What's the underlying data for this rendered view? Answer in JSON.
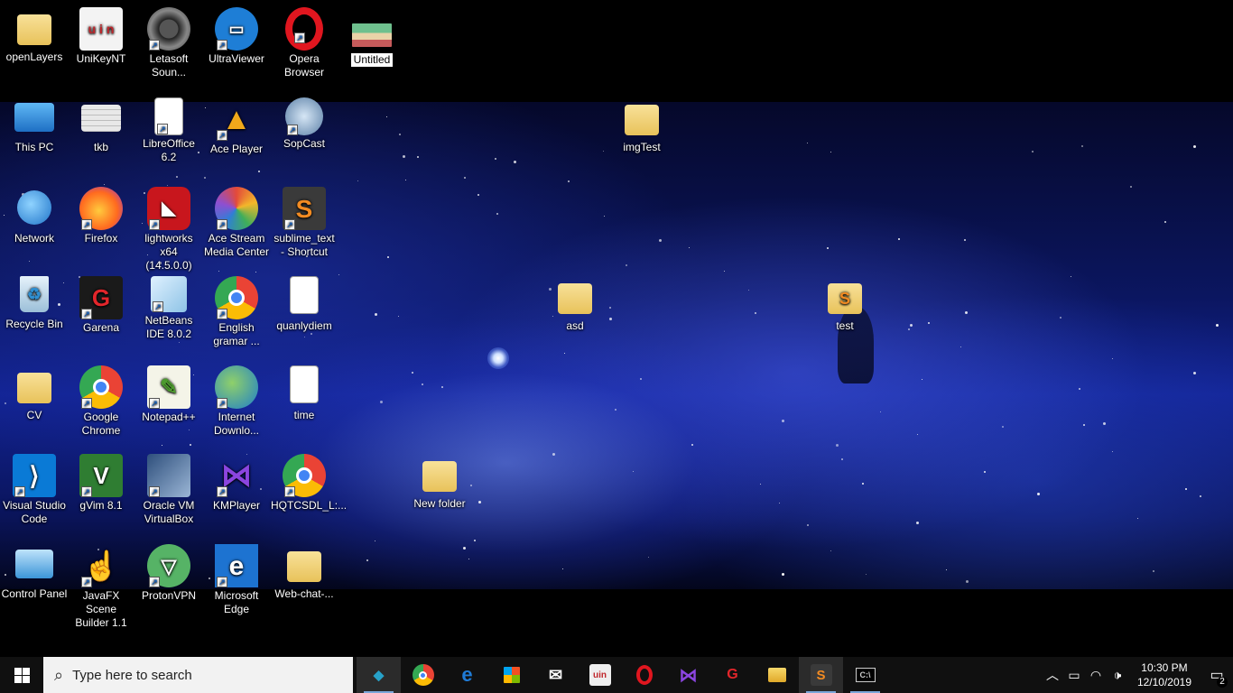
{
  "desktop": {
    "icons": [
      {
        "label": "openLayers",
        "kind": "folder"
      },
      {
        "label": "UniKeyNT",
        "kind": "app"
      },
      {
        "label": "Letasoft Soun...",
        "kind": "app"
      },
      {
        "label": "UltraViewer",
        "kind": "app"
      },
      {
        "label": "Opera Browser",
        "kind": "app"
      },
      {
        "label": "Untitled",
        "kind": "image",
        "renaming": true
      },
      {
        "label": "This PC",
        "kind": "system"
      },
      {
        "label": "tkb",
        "kind": "file"
      },
      {
        "label": "LibreOffice 6.2",
        "kind": "app"
      },
      {
        "label": "Ace Player",
        "kind": "app"
      },
      {
        "label": "SopCast",
        "kind": "app"
      },
      {
        "label": "imgTest",
        "kind": "folder"
      },
      {
        "label": "Network",
        "kind": "system"
      },
      {
        "label": "Firefox",
        "kind": "app"
      },
      {
        "label": "lightworks x64 (14.5.0.0)",
        "kind": "app"
      },
      {
        "label": "Ace Stream Media Center",
        "kind": "app"
      },
      {
        "label": "sublime_text - Shortcut",
        "kind": "app"
      },
      {
        "label": "Recycle Bin",
        "kind": "system"
      },
      {
        "label": "Garena",
        "kind": "app"
      },
      {
        "label": "NetBeans IDE 8.0.2",
        "kind": "app"
      },
      {
        "label": "English gramar ...",
        "kind": "app"
      },
      {
        "label": "quanlydiem",
        "kind": "file"
      },
      {
        "label": "asd",
        "kind": "folder"
      },
      {
        "label": "test",
        "kind": "folder"
      },
      {
        "label": "CV",
        "kind": "folder"
      },
      {
        "label": "Google Chrome",
        "kind": "app"
      },
      {
        "label": "Notepad++",
        "kind": "app"
      },
      {
        "label": "Internet Downlo...",
        "kind": "app"
      },
      {
        "label": "time",
        "kind": "file"
      },
      {
        "label": "Visual Studio Code",
        "kind": "app"
      },
      {
        "label": "gVim 8.1",
        "kind": "app"
      },
      {
        "label": "Oracle VM VirtualBox",
        "kind": "app"
      },
      {
        "label": "KMPlayer",
        "kind": "app"
      },
      {
        "label": "HQTCSDL_L:...",
        "kind": "app"
      },
      {
        "label": "New folder",
        "kind": "folder"
      },
      {
        "label": "Control Panel",
        "kind": "system"
      },
      {
        "label": "JavaFX Scene Builder 1.1",
        "kind": "app"
      },
      {
        "label": "ProtonVPN",
        "kind": "app"
      },
      {
        "label": "Microsoft Edge",
        "kind": "app"
      },
      {
        "label": "Web-chat-...",
        "kind": "folder"
      }
    ]
  },
  "taskbar": {
    "search_placeholder": "Type here to search",
    "pinned": [
      {
        "name": "git-kraken-icon",
        "color": "#27a2c9"
      },
      {
        "name": "chrome-icon",
        "color": "#e2463a"
      },
      {
        "name": "edge-icon",
        "color": "#1f7bd6"
      },
      {
        "name": "store-icon",
        "color": "#f2f2f2"
      },
      {
        "name": "mail-icon",
        "color": "#f2f2f2"
      },
      {
        "name": "unikey-icon",
        "color": "#e04444"
      },
      {
        "name": "opera-icon",
        "color": "#e0161f"
      },
      {
        "name": "kmplayer-icon",
        "color": "#7b3fd1"
      },
      {
        "name": "garena-icon",
        "color": "#d61f1f"
      },
      {
        "name": "file-explorer-icon",
        "color": "#f0c23b"
      },
      {
        "name": "sublime-icon",
        "color": "#f28b22"
      },
      {
        "name": "terminal-icon",
        "color": "#cccccc"
      }
    ],
    "clock": {
      "time": "10:30 PM",
      "date": "12/10/2019"
    },
    "notification_count": "2"
  }
}
